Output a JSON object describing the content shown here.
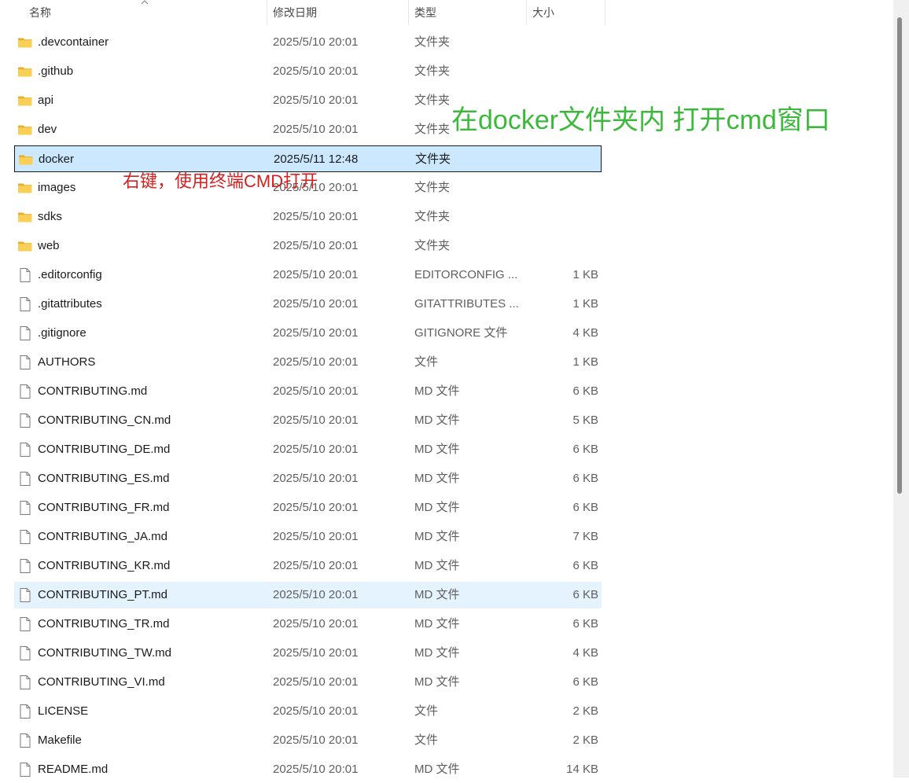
{
  "columns": {
    "name": "名称",
    "date": "修改日期",
    "type": "类型",
    "size": "大小"
  },
  "files": [
    {
      "name": ".devcontainer",
      "date": "2025/5/10 20:01",
      "type": "文件夹",
      "size": "",
      "icon": "folder-icon"
    },
    {
      "name": ".github",
      "date": "2025/5/10 20:01",
      "type": "文件夹",
      "size": "",
      "icon": "folder-icon"
    },
    {
      "name": "api",
      "date": "2025/5/10 20:01",
      "type": "文件夹",
      "size": "",
      "icon": "folder-icon"
    },
    {
      "name": "dev",
      "date": "2025/5/10 20:01",
      "type": "文件夹",
      "size": "",
      "icon": "folder-icon"
    },
    {
      "name": "docker",
      "date": "2025/5/11 12:48",
      "type": "文件夹",
      "size": "",
      "icon": "folder-icon",
      "state": "selected"
    },
    {
      "name": "images",
      "date": "2025/5/10 20:01",
      "type": "文件夹",
      "size": "",
      "icon": "folder-icon"
    },
    {
      "name": "sdks",
      "date": "2025/5/10 20:01",
      "type": "文件夹",
      "size": "",
      "icon": "folder-icon"
    },
    {
      "name": "web",
      "date": "2025/5/10 20:01",
      "type": "文件夹",
      "size": "",
      "icon": "folder-icon"
    },
    {
      "name": ".editorconfig",
      "date": "2025/5/10 20:01",
      "type": "EDITORCONFIG ...",
      "size": "1 KB",
      "icon": "file-icon"
    },
    {
      "name": ".gitattributes",
      "date": "2025/5/10 20:01",
      "type": "GITATTRIBUTES ...",
      "size": "1 KB",
      "icon": "file-icon"
    },
    {
      "name": ".gitignore",
      "date": "2025/5/10 20:01",
      "type": "GITIGNORE 文件",
      "size": "4 KB",
      "icon": "file-icon"
    },
    {
      "name": "AUTHORS",
      "date": "2025/5/10 20:01",
      "type": "文件",
      "size": "1 KB",
      "icon": "file-icon"
    },
    {
      "name": "CONTRIBUTING.md",
      "date": "2025/5/10 20:01",
      "type": "MD 文件",
      "size": "6 KB",
      "icon": "file-icon"
    },
    {
      "name": "CONTRIBUTING_CN.md",
      "date": "2025/5/10 20:01",
      "type": "MD 文件",
      "size": "5 KB",
      "icon": "file-icon"
    },
    {
      "name": "CONTRIBUTING_DE.md",
      "date": "2025/5/10 20:01",
      "type": "MD 文件",
      "size": "6 KB",
      "icon": "file-icon"
    },
    {
      "name": "CONTRIBUTING_ES.md",
      "date": "2025/5/10 20:01",
      "type": "MD 文件",
      "size": "6 KB",
      "icon": "file-icon"
    },
    {
      "name": "CONTRIBUTING_FR.md",
      "date": "2025/5/10 20:01",
      "type": "MD 文件",
      "size": "6 KB",
      "icon": "file-icon"
    },
    {
      "name": "CONTRIBUTING_JA.md",
      "date": "2025/5/10 20:01",
      "type": "MD 文件",
      "size": "7 KB",
      "icon": "file-icon"
    },
    {
      "name": "CONTRIBUTING_KR.md",
      "date": "2025/5/10 20:01",
      "type": "MD 文件",
      "size": "6 KB",
      "icon": "file-icon"
    },
    {
      "name": "CONTRIBUTING_PT.md",
      "date": "2025/5/10 20:01",
      "type": "MD 文件",
      "size": "6 KB",
      "icon": "file-icon",
      "state": "hover"
    },
    {
      "name": "CONTRIBUTING_TR.md",
      "date": "2025/5/10 20:01",
      "type": "MD 文件",
      "size": "6 KB",
      "icon": "file-icon"
    },
    {
      "name": "CONTRIBUTING_TW.md",
      "date": "2025/5/10 20:01",
      "type": "MD 文件",
      "size": "4 KB",
      "icon": "file-icon"
    },
    {
      "name": "CONTRIBUTING_VI.md",
      "date": "2025/5/10 20:01",
      "type": "MD 文件",
      "size": "6 KB",
      "icon": "file-icon"
    },
    {
      "name": "LICENSE",
      "date": "2025/5/10 20:01",
      "type": "文件",
      "size": "2 KB",
      "icon": "file-icon"
    },
    {
      "name": "Makefile",
      "date": "2025/5/10 20:01",
      "type": "文件",
      "size": "2 KB",
      "icon": "file-icon"
    },
    {
      "name": "README.md",
      "date": "2025/5/10 20:01",
      "type": "MD 文件",
      "size": "14 KB",
      "icon": "file-icon"
    }
  ],
  "annotations": {
    "green": "在docker文件夹内 打开cmd窗口",
    "red": "右键，使用终端CMD打开"
  },
  "colors": {
    "selected_bg": "#cce8ff",
    "hover_bg": "#e5f3ff",
    "folder": "#f5c542",
    "annotation_green": "#3cb93c",
    "annotation_red": "#d42020"
  }
}
